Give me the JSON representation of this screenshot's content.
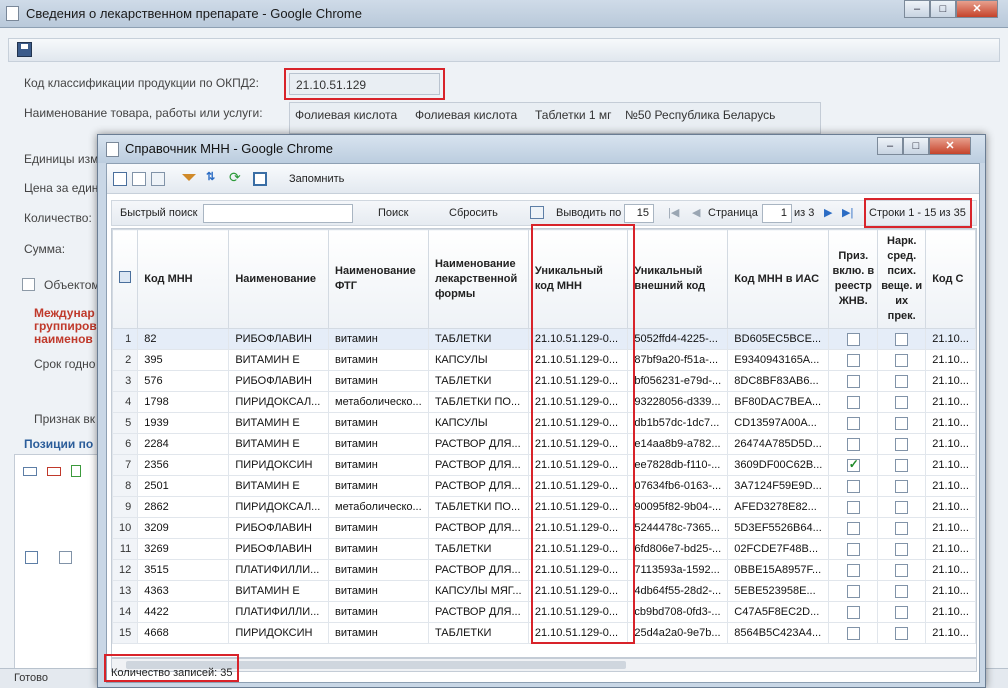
{
  "outer_window": {
    "title": "Сведения о лекарственном препарате - Google Chrome",
    "buttons": {
      "minimize": "–",
      "maximize": "□",
      "close": "✕"
    }
  },
  "outer_form": {
    "okpd_label": "Код классификации продукции по ОКПД2:",
    "okpd_value": "21.10.51.129",
    "name_label": "Наименование товара, работы или услуги:",
    "name_parts": [
      "Фолиевая кислота",
      "Фолиевая кислота",
      "Таблетки 1 мг",
      "№50 Республика Беларусь"
    ],
    "units_label": "Единицы изм",
    "price_label": "Цена за един",
    "qty_label": "Количество:",
    "sum_label": "Сумма:",
    "object_label": "Объектом",
    "intl_label_1": "Междунар",
    "intl_label_2": "группиров",
    "intl_label_3": "наименов",
    "term_label": "Срок годно",
    "sign_label": "Признак вк",
    "positions_label": "Позиции по",
    "status": "Готово"
  },
  "modal": {
    "title": "Справочник МНН - Google Chrome",
    "remember_label": "Запомнить",
    "quick_search_label": "Быстрый поиск",
    "search_button": "Поиск",
    "reset_button": "Сбросить",
    "per_page_label": "Выводить по",
    "per_page_value": "15",
    "page_label": "Страница",
    "page_value": "1",
    "page_of": "из 3",
    "rows_info": "Строки 1 - 15 из 35",
    "records_count": "Количество записей: 35",
    "columns": [
      "Код МНН",
      "Наименование",
      "Наименование ФТГ",
      "Наименование лекарственной формы",
      "Уникальный код МНН",
      "Уникальный внешний код",
      "Код МНН в ИАС",
      "Признак включения в реестр ЖНВЛП",
      "Наркотические средства, психотропные вещества и их прекурсоры",
      "Код С"
    ],
    "columns_display": [
      "Код МНН",
      "Наименование",
      "Наименование ФТГ",
      "Наименование лекарственной формы",
      "Уникальный код МНН",
      "Уникальный внешний код",
      "Код МНН в ИАС",
      "Приз. вклю. в реестр ЖНВ.",
      "Нарк. сред. псих. веще. и их прек.",
      "Код С"
    ],
    "rows": [
      {
        "n": "1",
        "code": "82",
        "name": "РИБОФЛАВИН",
        "ftg": "витамин",
        "form": "ТАБЛЕТКИ",
        "uniq": "21.10.51.129-0...",
        "ext": "5052ffd4-4225-...",
        "ias": "BD605EC5BCE...",
        "gnvlp": false,
        "narc": false,
        "kod": "21.10..."
      },
      {
        "n": "2",
        "code": "395",
        "name": "ВИТАМИН Е",
        "ftg": "витамин",
        "form": "КАПСУЛЫ",
        "uniq": "21.10.51.129-0...",
        "ext": "87bf9a20-f51a-...",
        "ias": "E9340943165A...",
        "gnvlp": false,
        "narc": false,
        "kod": "21.10..."
      },
      {
        "n": "3",
        "code": "576",
        "name": "РИБОФЛАВИН",
        "ftg": "витамин",
        "form": "ТАБЛЕТКИ",
        "uniq": "21.10.51.129-0...",
        "ext": "bf056231-e79d-...",
        "ias": "8DC8BF83AB6...",
        "gnvlp": false,
        "narc": false,
        "kod": "21.10..."
      },
      {
        "n": "4",
        "code": "1798",
        "name": "ПИРИДОКСАЛ...",
        "ftg": "метаболическо...",
        "form": "ТАБЛЕТКИ ПО...",
        "uniq": "21.10.51.129-0...",
        "ext": "93228056-d339...",
        "ias": "BF80DAC7BEA...",
        "gnvlp": false,
        "narc": false,
        "kod": "21.10..."
      },
      {
        "n": "5",
        "code": "1939",
        "name": "ВИТАМИН Е",
        "ftg": "витамин",
        "form": "КАПСУЛЫ",
        "uniq": "21.10.51.129-0...",
        "ext": "db1b57dc-1dc7...",
        "ias": "CD13597A00A...",
        "gnvlp": false,
        "narc": false,
        "kod": "21.10..."
      },
      {
        "n": "6",
        "code": "2284",
        "name": "ВИТАМИН Е",
        "ftg": "витамин",
        "form": "РАСТВОР ДЛЯ...",
        "uniq": "21.10.51.129-0...",
        "ext": "e14aa8b9-a782...",
        "ias": "26474A785D5D...",
        "gnvlp": false,
        "narc": false,
        "kod": "21.10..."
      },
      {
        "n": "7",
        "code": "2356",
        "name": "ПИРИДОКСИН",
        "ftg": "витамин",
        "form": "РАСТВОР ДЛЯ...",
        "uniq": "21.10.51.129-0...",
        "ext": "ee7828db-f110-...",
        "ias": "3609DF00C62B...",
        "gnvlp": true,
        "narc": false,
        "kod": "21.10..."
      },
      {
        "n": "8",
        "code": "2501",
        "name": "ВИТАМИН Е",
        "ftg": "витамин",
        "form": "РАСТВОР ДЛЯ...",
        "uniq": "21.10.51.129-0...",
        "ext": "07634fb6-0163-...",
        "ias": "3A7124F59E9D...",
        "gnvlp": false,
        "narc": false,
        "kod": "21.10..."
      },
      {
        "n": "9",
        "code": "2862",
        "name": "ПИРИДОКСАЛ...",
        "ftg": "метаболическо...",
        "form": "ТАБЛЕТКИ ПО...",
        "uniq": "21.10.51.129-0...",
        "ext": "90095f82-9b04-...",
        "ias": "AFED3278E82...",
        "gnvlp": false,
        "narc": false,
        "kod": "21.10..."
      },
      {
        "n": "10",
        "code": "3209",
        "name": "РИБОФЛАВИН",
        "ftg": "витамин",
        "form": "РАСТВОР ДЛЯ...",
        "uniq": "21.10.51.129-0...",
        "ext": "5244478c-7365...",
        "ias": "5D3EF5526B64...",
        "gnvlp": false,
        "narc": false,
        "kod": "21.10..."
      },
      {
        "n": "11",
        "code": "3269",
        "name": "РИБОФЛАВИН",
        "ftg": "витамин",
        "form": "ТАБЛЕТКИ",
        "uniq": "21.10.51.129-0...",
        "ext": "6fd806e7-bd25-...",
        "ias": "02FCDE7F48B...",
        "gnvlp": false,
        "narc": false,
        "kod": "21.10..."
      },
      {
        "n": "12",
        "code": "3515",
        "name": "ПЛАТИФИЛЛИ...",
        "ftg": "витамин",
        "form": "РАСТВОР ДЛЯ...",
        "uniq": "21.10.51.129-0...",
        "ext": "7113593a-1592...",
        "ias": "0BBE15A8957F...",
        "gnvlp": false,
        "narc": false,
        "kod": "21.10..."
      },
      {
        "n": "13",
        "code": "4363",
        "name": "ВИТАМИН Е",
        "ftg": "витамин",
        "form": "КАПСУЛЫ МЯГ...",
        "uniq": "21.10.51.129-0...",
        "ext": "4db64f55-28d2-...",
        "ias": "5EBE523958E...",
        "gnvlp": false,
        "narc": false,
        "kod": "21.10..."
      },
      {
        "n": "14",
        "code": "4422",
        "name": "ПЛАТИФИЛЛИ...",
        "ftg": "витамин",
        "form": "РАСТВОР ДЛЯ...",
        "uniq": "21.10.51.129-0...",
        "ext": "cb9bd708-0fd3-...",
        "ias": "C47A5F8EC2D...",
        "gnvlp": false,
        "narc": false,
        "kod": "21.10..."
      },
      {
        "n": "15",
        "code": "4668",
        "name": "ПИРИДОКСИН",
        "ftg": "витамин",
        "form": "ТАБЛЕТКИ",
        "uniq": "21.10.51.129-0...",
        "ext": "25d4a2a0-9e7b...",
        "ias": "8564B5C423A4...",
        "gnvlp": false,
        "narc": false,
        "kod": "21.10..."
      }
    ]
  },
  "icons": [
    "document-icon",
    "save-icon",
    "new-icon",
    "edit-icon",
    "copy-icon",
    "filter-icon",
    "sort-icon",
    "refresh-icon",
    "export-icon",
    "grid-icon",
    "first-page-icon",
    "prev-page-icon",
    "next-page-icon",
    "last-page-icon",
    "columns-icon"
  ],
  "colors": {
    "highlight": "#d8232a",
    "checked": "#1e8a28"
  }
}
